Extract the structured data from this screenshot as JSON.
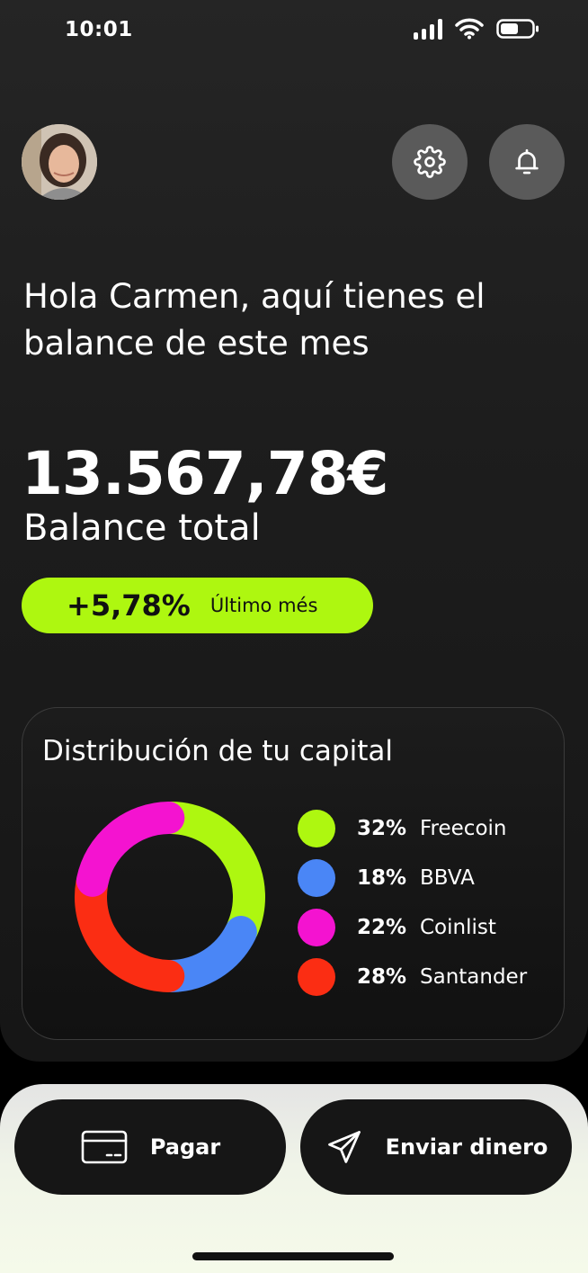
{
  "status_bar": {
    "time": "10:01"
  },
  "header": {
    "avatar_icon": "user-avatar",
    "settings_icon": "gear-icon",
    "notifications_icon": "bell-icon"
  },
  "greeting": "Hola Carmen, aquí tienes el balance de este mes",
  "balance": {
    "amount": "13.567,78€",
    "label": "Balance total",
    "change_value": "+5,78%",
    "change_period": "Último més"
  },
  "distribution": {
    "title": "Distribución de tu capital",
    "items": [
      {
        "pct": "32%",
        "name": "Freecoin",
        "value": 32,
        "color": "#aef710"
      },
      {
        "pct": "18%",
        "name": "BBVA",
        "value": 18,
        "color": "#4a86f6"
      },
      {
        "pct": "22%",
        "name": "Coinlist",
        "value": 22,
        "color": "#f413d0"
      },
      {
        "pct": "28%",
        "name": "Santander",
        "value": 28,
        "color": "#fb2d13"
      }
    ],
    "donut_order": [
      "Freecoin",
      "BBVA",
      "Santander",
      "Coinlist"
    ]
  },
  "actions": {
    "pay_label": "Pagar",
    "pay_icon": "credit-card-icon",
    "send_label": "Enviar dinero",
    "send_icon": "paper-plane-icon"
  },
  "colors": {
    "accent": "#aef710",
    "background": "#1d1d1d",
    "button_dark": "#161616"
  }
}
